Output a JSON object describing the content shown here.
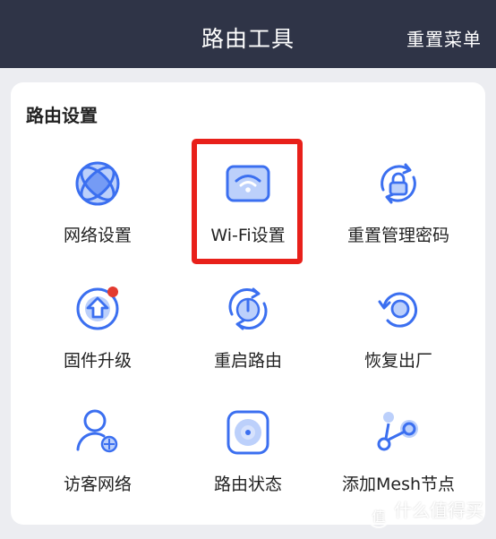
{
  "header": {
    "title": "路由工具",
    "reset_menu": "重置菜单"
  },
  "section": {
    "title": "路由设置"
  },
  "tiles": [
    {
      "label": "网络设置",
      "icon": "globe-icon"
    },
    {
      "label": "Wi-Fi设置",
      "icon": "wifi-router-icon",
      "highlighted": true
    },
    {
      "label": "重置管理密码",
      "icon": "lock-reset-icon"
    },
    {
      "label": "固件升级",
      "icon": "firmware-upgrade-icon",
      "badge": true
    },
    {
      "label": "重启路由",
      "icon": "power-restart-icon"
    },
    {
      "label": "恢复出厂",
      "icon": "factory-reset-icon"
    },
    {
      "label": "访客网络",
      "icon": "guest-user-icon"
    },
    {
      "label": "路由状态",
      "icon": "router-status-icon"
    },
    {
      "label": "添加Mesh节点",
      "icon": "mesh-node-icon"
    }
  ],
  "watermark": {
    "text": "什么值得买",
    "icon_char": "值"
  },
  "colors": {
    "header_bg": "#2f3447",
    "page_bg": "#ecedf1",
    "icon_blue": "#3b6ff0",
    "icon_light": "#bcd0fb",
    "highlight_red": "#e8201a",
    "badge_red": "#e33a2f"
  }
}
